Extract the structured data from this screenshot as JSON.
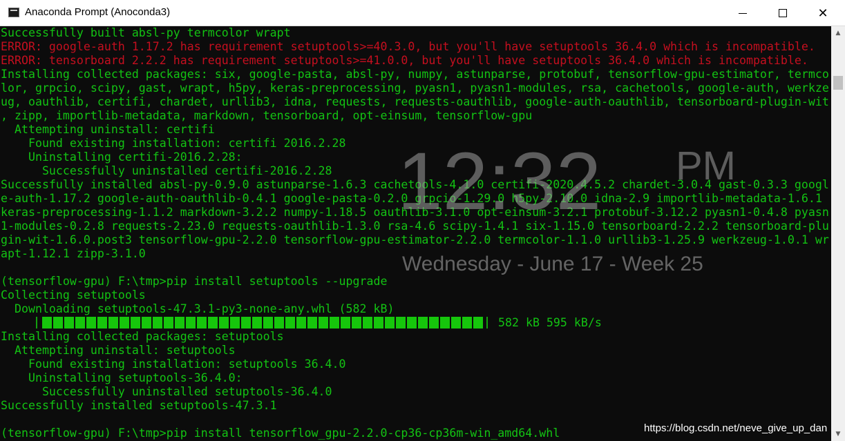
{
  "window": {
    "title": "Anaconda Prompt (Anoconda3)",
    "minimize_glyph": "",
    "close_glyph": "✕"
  },
  "colors": {
    "background": "#0c0c0c",
    "text": "#13c313",
    "error": "#c50f1f",
    "progress_fill": "#16c60c"
  },
  "console": {
    "lines": [
      {
        "text": "Successfully built absl-py termcolor wrapt",
        "color": "green"
      },
      {
        "text": "ERROR: google-auth 1.17.2 has requirement setuptools>=40.3.0, but you'll have setuptools 36.4.0 which is incompatible.",
        "color": "red"
      },
      {
        "text": "ERROR: tensorboard 2.2.2 has requirement setuptools>=41.0.0, but you'll have setuptools 36.4.0 which is incompatible.",
        "color": "red"
      },
      {
        "text": "Installing collected packages: six, google-pasta, absl-py, numpy, astunparse, protobuf, tensorflow-gpu-estimator, termco",
        "color": "green"
      },
      {
        "text": "lor, grpcio, scipy, gast, wrapt, h5py, keras-preprocessing, pyasn1, pyasn1-modules, rsa, cachetools, google-auth, werkze",
        "color": "green"
      },
      {
        "text": "ug, oauthlib, certifi, chardet, urllib3, idna, requests, requests-oauthlib, google-auth-oauthlib, tensorboard-plugin-wit",
        "color": "green"
      },
      {
        "text": ", zipp, importlib-metadata, markdown, tensorboard, opt-einsum, tensorflow-gpu",
        "color": "green"
      },
      {
        "text": "  Attempting uninstall: certifi",
        "color": "green"
      },
      {
        "text": "    Found existing installation: certifi 2016.2.28",
        "color": "green"
      },
      {
        "text": "    Uninstalling certifi-2016.2.28:",
        "color": "green"
      },
      {
        "text": "      Successfully uninstalled certifi-2016.2.28",
        "color": "green"
      },
      {
        "text": "Successfully installed absl-py-0.9.0 astunparse-1.6.3 cachetools-4.1.0 certifi-2020.4.5.2 chardet-3.0.4 gast-0.3.3 googl",
        "color": "green"
      },
      {
        "text": "e-auth-1.17.2 google-auth-oauthlib-0.4.1 google-pasta-0.2.0 grpcio-1.29.0 h5py-2.10.0 idna-2.9 importlib-metadata-1.6.1",
        "color": "green"
      },
      {
        "text": "keras-preprocessing-1.1.2 markdown-3.2.2 numpy-1.18.5 oauthlib-3.1.0 opt-einsum-3.2.1 protobuf-3.12.2 pyasn1-0.4.8 pyasn",
        "color": "green"
      },
      {
        "text": "1-modules-0.2.8 requests-2.23.0 requests-oauthlib-1.3.0 rsa-4.6 scipy-1.4.1 six-1.15.0 tensorboard-2.2.2 tensorboard-plu",
        "color": "green"
      },
      {
        "text": "gin-wit-1.6.0.post3 tensorflow-gpu-2.2.0 tensorflow-gpu-estimator-2.2.0 termcolor-1.1.0 urllib3-1.25.9 werkzeug-1.0.1 wr",
        "color": "green"
      },
      {
        "text": "apt-1.12.1 zipp-3.1.0",
        "color": "green"
      },
      {
        "text": "",
        "color": "green"
      },
      {
        "text": "(tensorflow-gpu) F:\\tmp>pip install setuptools --upgrade",
        "color": "green"
      },
      {
        "text": "Collecting setuptools",
        "color": "green"
      },
      {
        "text": "  Downloading setuptools-47.3.1-py3-none-any.whl (582 kB)",
        "color": "green"
      },
      {
        "text": "",
        "color": "green"
      },
      {
        "text": "Installing collected packages: setuptools",
        "color": "green"
      },
      {
        "text": "  Attempting uninstall: setuptools",
        "color": "green"
      },
      {
        "text": "    Found existing installation: setuptools 36.4.0",
        "color": "green"
      },
      {
        "text": "    Uninstalling setuptools-36.4.0:",
        "color": "green"
      },
      {
        "text": "      Successfully uninstalled setuptools-36.4.0",
        "color": "green"
      },
      {
        "text": "Successfully installed setuptools-47.3.1",
        "color": "green"
      },
      {
        "text": "",
        "color": "green"
      },
      {
        "text": "(tensorflow-gpu) F:\\tmp>pip install tensorflow_gpu-2.2.0-cp36-cp36m-win_amd64.whl",
        "color": "green"
      }
    ]
  },
  "progress": {
    "fraction": 1.0,
    "status": "582 kB 595 kB/s"
  },
  "clock_overlay": {
    "time": "12:32",
    "ampm": "PM",
    "date": "Wednesday - June 17 - Week 25"
  },
  "watermark": "https://blog.csdn.net/neve_give_up_dan"
}
